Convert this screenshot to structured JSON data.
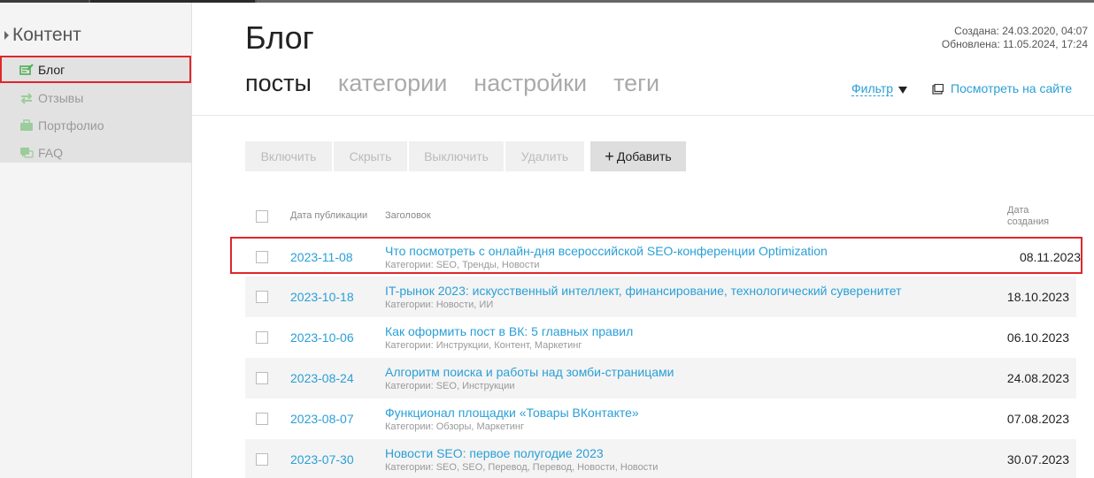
{
  "sidebar": {
    "header": "Контент",
    "items": [
      {
        "label": "Блог",
        "icon": "blog-edit-icon",
        "active": true
      },
      {
        "label": "Отзывы",
        "icon": "arrows-exchange-icon",
        "active": false
      },
      {
        "label": "Портфолио",
        "icon": "briefcase-icon",
        "active": false
      },
      {
        "label": "FAQ",
        "icon": "faq-chat-icon",
        "active": false
      }
    ]
  },
  "page": {
    "title": "Блог",
    "created": "Создана: 24.03.2020, 04:07",
    "updated": "Обновлена: 11.05.2024, 17:24"
  },
  "tabs": [
    {
      "label": "посты",
      "active": true
    },
    {
      "label": "категории",
      "active": false
    },
    {
      "label": "настройки",
      "active": false
    },
    {
      "label": "теги",
      "active": false
    }
  ],
  "filter": {
    "label": "Фильтр"
  },
  "view_site": {
    "label": "Посмотреть на сайте"
  },
  "toolbar": {
    "enable": "Включить",
    "hide": "Скрыть",
    "disable": "Выключить",
    "delete": "Удалить",
    "add": "Добавить"
  },
  "table": {
    "headers": {
      "date": "Дата публикации",
      "title": "Заголовок",
      "created_line1": "Дата",
      "created_line2": "создания"
    },
    "rows": [
      {
        "date": "2023-11-08",
        "title": "Что посмотреть с онлайн-дня всероссийской SEO-конференции Optimization",
        "categories": "Категории: SEO, Тренды, Новости",
        "created": "08.11.2023"
      },
      {
        "date": "2023-10-18",
        "title": "IT-рынок 2023: искусственный интеллект, финансирование, технологический суверенитет",
        "categories": "Категории: Новости, ИИ",
        "created": "18.10.2023"
      },
      {
        "date": "2023-10-06",
        "title": "Как оформить пост в ВК: 5 главных правил",
        "categories": "Категории: Инструкции, Контент, Маркетинг",
        "created": "06.10.2023"
      },
      {
        "date": "2023-08-24",
        "title": "Алгоритм поиска и работы над зомби-страницами",
        "categories": "Категории: SEO, Инструкции",
        "created": "24.08.2023"
      },
      {
        "date": "2023-08-07",
        "title": "Функционал площадки «Товары ВКонтакте»",
        "categories": "Категории: Обзоры, Маркетинг",
        "created": "07.08.2023"
      },
      {
        "date": "2023-07-30",
        "title": "Новости SEO: первое полугодие 2023",
        "categories": "Категории: SEO, SEO, Перевод, Перевод, Новости, Новости",
        "created": "30.07.2023"
      }
    ]
  },
  "colors": {
    "link": "#2a9fd6",
    "highlight": "#e0262b",
    "icon_green": "#4caf50"
  }
}
